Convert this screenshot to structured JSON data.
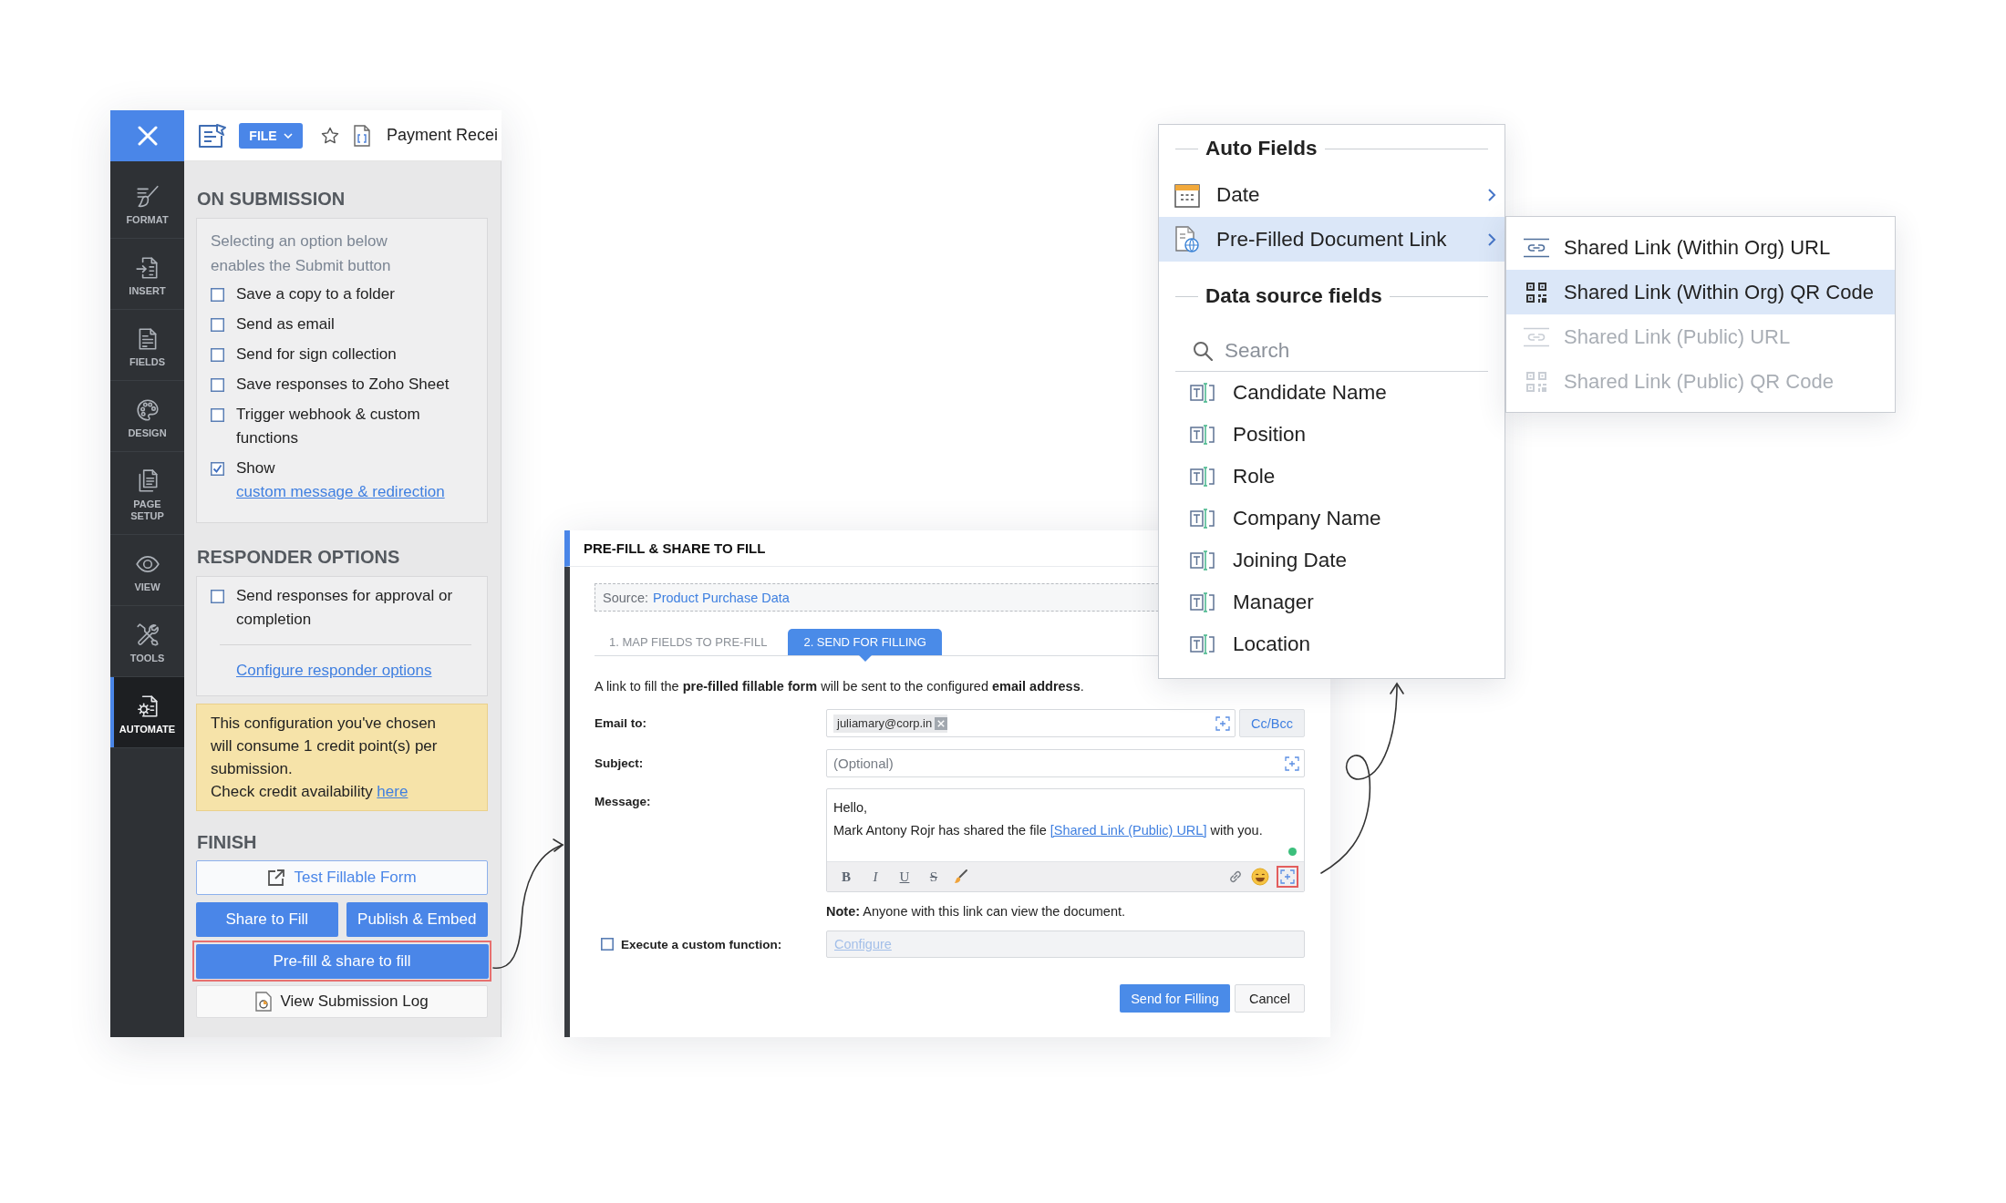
{
  "editor": {
    "header": {
      "file_button": "FILE",
      "document_title": "Payment Recei"
    },
    "sidebar": [
      {
        "label": "FORMAT",
        "selected": false
      },
      {
        "label": "INSERT",
        "selected": false
      },
      {
        "label": "FIELDS",
        "selected": false
      },
      {
        "label": "DESIGN",
        "selected": false
      },
      {
        "label": "PAGE SETUP",
        "selected": false
      },
      {
        "label": "VIEW",
        "selected": false
      },
      {
        "label": "TOOLS",
        "selected": false
      },
      {
        "label": "AUTOMATE",
        "selected": true
      }
    ],
    "on_submission": {
      "title": "ON SUBMISSION",
      "hint": "Selecting an option below enables the Submit button",
      "options": [
        {
          "label": "Save a copy to a folder",
          "checked": false
        },
        {
          "label": "Send as email",
          "checked": false
        },
        {
          "label": "Send for sign collection",
          "checked": false
        },
        {
          "label": "Save responses to Zoho Sheet",
          "checked": false
        },
        {
          "label": "Trigger webhook & custom functions",
          "checked": false
        },
        {
          "label": "Show",
          "link": "custom message & redirection",
          "checked": true
        }
      ]
    },
    "responder_options": {
      "title": "RESPONDER OPTIONS",
      "options": [
        {
          "label": "Send responses for approval or completion",
          "checked": false
        }
      ],
      "link": "Configure responder options"
    },
    "credit_note": {
      "text": "This configuration you've chosen will consume 1 credit point(s) per submission.",
      "check_text": "Check credit availability",
      "link": "here"
    },
    "finish": {
      "title": "FINISH",
      "rows": [
        [
          {
            "label": "Test Fillable Form",
            "kind": "outline",
            "highlighted": false
          }
        ],
        [
          {
            "label": "Share to Fill",
            "kind": "primary",
            "highlighted": false
          },
          {
            "label": "Publish & Embed",
            "kind": "primary",
            "highlighted": false
          }
        ],
        [
          {
            "label": "Pre-fill & share to fill",
            "kind": "primary",
            "highlighted": true
          }
        ],
        [
          {
            "label": "View Submission Log",
            "kind": "plain",
            "highlighted": false
          }
        ]
      ]
    }
  },
  "dialog": {
    "title": "PRE-FILL & SHARE TO FILL",
    "source": {
      "label": "Source:",
      "value": "Product Purchase Data"
    },
    "tabs": [
      {
        "label": "1. MAP FIELDS TO PRE-FILL",
        "selected": false
      },
      {
        "label": "2. SEND FOR FILLING",
        "selected": true
      }
    ],
    "description": "A link to fill the **pre-filled fillable form** will be sent to the configured **email address**.",
    "email": {
      "label": "Email to:",
      "recipients": [
        "juliamary@corp.in"
      ],
      "cc_button": "Cc/Bcc"
    },
    "subject": {
      "label": "Subject:",
      "placeholder": "(Optional)"
    },
    "message": {
      "label": "Message:",
      "lines": [
        {
          "text": "Hello,"
        },
        {
          "text": "Mark Antony Rojr has shared the file",
          "link": "[Shared Link (Public) URL]",
          "after": "with you."
        }
      ],
      "toolbar": [
        {
          "label": "B",
          "kind": "bold"
        },
        {
          "label": "I",
          "kind": "italic"
        },
        {
          "label": "U",
          "kind": "underline"
        },
        {
          "label": "S",
          "kind": "strike"
        }
      ],
      "insert_highlighted": true
    },
    "note": "**Note:** Anyone with this link can view the document.",
    "custom_function": {
      "label": "Execute a custom function:",
      "checked": false,
      "link": "Configure"
    },
    "buttons": [
      {
        "label": "Send for Filling",
        "kind": "primary"
      },
      {
        "label": "Cancel",
        "kind": "secondary"
      }
    ]
  },
  "field_menu": {
    "sections": [
      {
        "title": "Auto Fields",
        "items": [
          {
            "label": "Date",
            "kind": "date",
            "selected": false,
            "submenu": true
          },
          {
            "label": "Pre-Filled Document Link",
            "kind": "document_link",
            "selected": true,
            "submenu": true
          }
        ]
      },
      {
        "title": "Data source fields",
        "search": {
          "placeholder": "Search"
        },
        "items": [
          {
            "label": "Candidate Name",
            "kind": "text_field",
            "selected": false
          },
          {
            "label": "Position",
            "kind": "text_field",
            "selected": false
          },
          {
            "label": "Role",
            "kind": "text_field",
            "selected": false
          },
          {
            "label": "Company Name",
            "kind": "text_field",
            "selected": false
          },
          {
            "label": "Joining Date",
            "kind": "text_field",
            "selected": false
          },
          {
            "label": "Manager",
            "kind": "text_field",
            "selected": false
          },
          {
            "label": "Location",
            "kind": "text_field",
            "selected": false
          }
        ]
      }
    ]
  },
  "link_submenu": {
    "items": [
      {
        "label": "Shared Link (Within Org) URL",
        "kind": "url",
        "selected": false,
        "disabled": false
      },
      {
        "label": "Shared Link (Within Org) QR Code",
        "kind": "qr",
        "selected": true,
        "disabled": false
      },
      {
        "label": "Shared Link (Public) URL",
        "kind": "url",
        "selected": false,
        "disabled": true
      },
      {
        "label": "Shared Link (Public) QR Code",
        "kind": "qr",
        "selected": false,
        "disabled": true
      }
    ]
  }
}
